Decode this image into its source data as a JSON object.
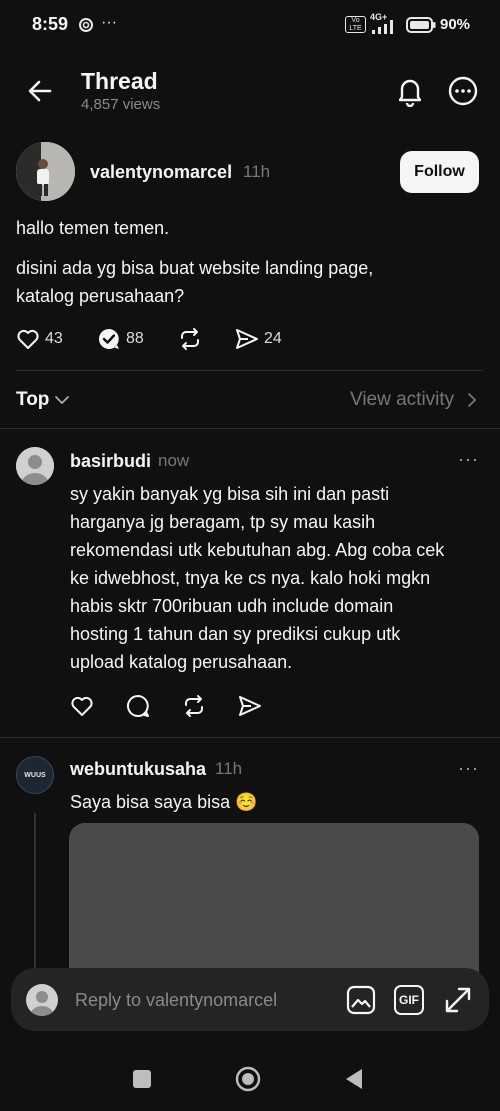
{
  "status_bar": {
    "time": "8:59",
    "battery": "90%",
    "network": "4G+",
    "volte": "Vo LTE"
  },
  "header": {
    "title": "Thread",
    "views": "4,857 views",
    "icons": [
      "back-arrow-icon",
      "bell-icon",
      "more-circle-icon"
    ]
  },
  "post": {
    "username": "valentynomarcel",
    "time": "11h",
    "follow_label": "Follow",
    "text_1": "hallo temen temen.",
    "text_2_line1": "disini ada yg bisa buat website landing page,",
    "text_2_line2": "katalog perusahaan?",
    "likes": "43",
    "replies": "88",
    "shares": "24"
  },
  "sort": {
    "label": "Top",
    "view_activity": "View activity"
  },
  "replies": [
    {
      "username": "basirbudi",
      "time": "now",
      "lines": [
        "sy yakin banyak yg bisa sih ini dan pasti",
        "harganya jg beragam, tp sy mau kasih",
        "rekomendasi utk kebutuhan abg. Abg coba cek",
        "ke idwebhost, tnya ke cs nya. kalo hoki mgkn",
        "habis sktr 700ribuan udh include domain",
        "hosting 1 tahun dan sy prediksi cukup utk",
        "upload katalog perusahaan."
      ]
    },
    {
      "username": "webuntukusaha",
      "time": "11h",
      "avatar_text": "WUUS",
      "text": "Saya bisa saya bisa ☺️"
    }
  ],
  "reply_bar": {
    "placeholder": "Reply to valentynomarcel",
    "gif_label": "GIF"
  },
  "colors": {
    "background": "#101010",
    "text": "#f3f5f7",
    "muted": "#777777"
  }
}
